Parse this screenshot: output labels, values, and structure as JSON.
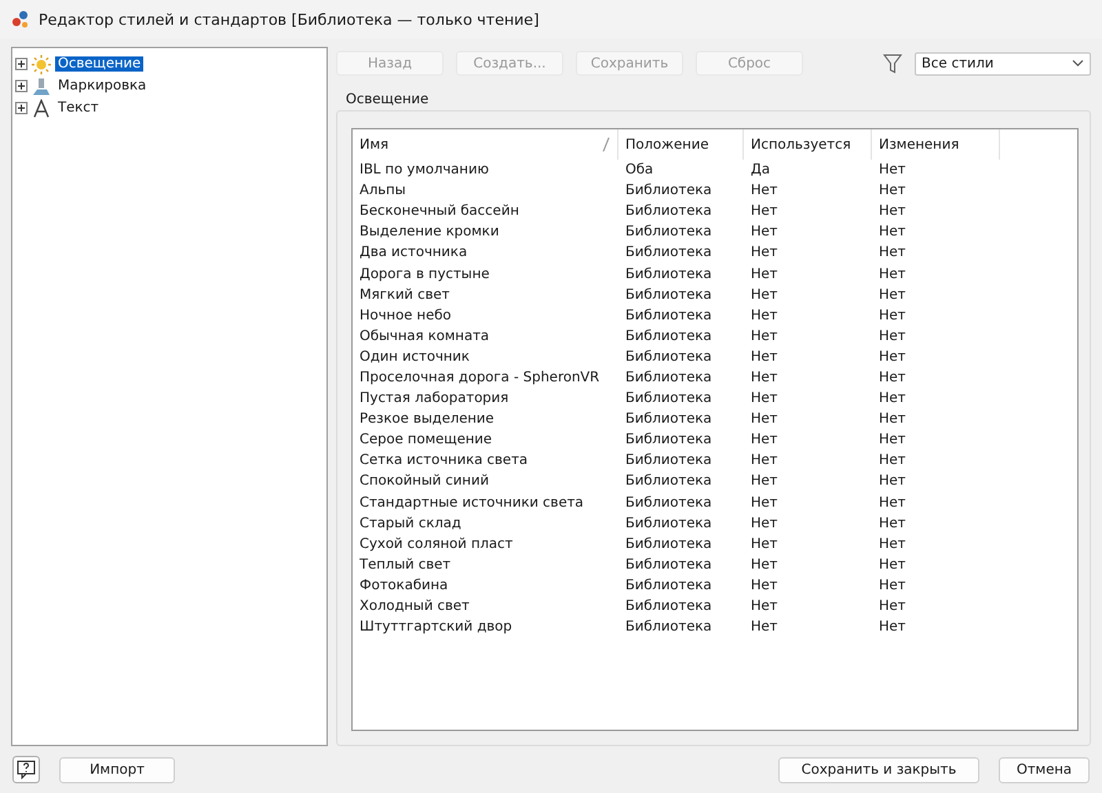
{
  "window": {
    "title": "Редактор стилей и стандартов [Библиотека — только чтение]"
  },
  "tree": [
    {
      "label": "Освещение",
      "selected": true,
      "expanded": false
    },
    {
      "label": "Маркировка",
      "selected": false,
      "expanded": false
    },
    {
      "label": "Текст",
      "selected": false,
      "expanded": false
    }
  ],
  "toolbar": [
    {
      "label": "Назад",
      "disabled": true
    },
    {
      "label": "Создать...",
      "disabled": true
    },
    {
      "label": "Сохранить",
      "disabled": true
    },
    {
      "label": "Сброс",
      "disabled": true
    }
  ],
  "filter": {
    "value": "Все стили"
  },
  "group": {
    "title": "Освещение"
  },
  "table": {
    "columns": [
      "Имя",
      "Положение",
      "Используется",
      "Изменения"
    ],
    "rows": [
      [
        "IBL по умолчанию",
        "Оба",
        "Да",
        "Нет"
      ],
      [
        "Альпы",
        "Библиотека",
        "Нет",
        "Нет"
      ],
      [
        "Бесконечный бассейн",
        "Библиотека",
        "Нет",
        "Нет"
      ],
      [
        "Выделение кромки",
        "Библиотека",
        "Нет",
        "Нет"
      ],
      [
        "Два источника",
        "Библиотека",
        "Нет",
        "Нет"
      ],
      [
        "Дорога в пустыне",
        "Библиотека",
        "Нет",
        "Нет"
      ],
      [
        "Мягкий свет",
        "Библиотека",
        "Нет",
        "Нет"
      ],
      [
        "Ночное небо",
        "Библиотека",
        "Нет",
        "Нет"
      ],
      [
        "Обычная комната",
        "Библиотека",
        "Нет",
        "Нет"
      ],
      [
        "Один источник",
        "Библиотека",
        "Нет",
        "Нет"
      ],
      [
        "Проселочная дорога - SpheronVR",
        "Библиотека",
        "Нет",
        "Нет"
      ],
      [
        "Пустая лаборатория",
        "Библиотека",
        "Нет",
        "Нет"
      ],
      [
        "Резкое выделение",
        "Библиотека",
        "Нет",
        "Нет"
      ],
      [
        "Серое помещение",
        "Библиотека",
        "Нет",
        "Нет"
      ],
      [
        "Сетка источника света",
        "Библиотека",
        "Нет",
        "Нет"
      ],
      [
        "Спокойный синий",
        "Библиотека",
        "Нет",
        "Нет"
      ],
      [
        "Стандартные источники света",
        "Библиотека",
        "Нет",
        "Нет"
      ],
      [
        "Старый склад",
        "Библиотека",
        "Нет",
        "Нет"
      ],
      [
        "Сухой соляной пласт",
        "Библиотека",
        "Нет",
        "Нет"
      ],
      [
        "Теплый свет",
        "Библиотека",
        "Нет",
        "Нет"
      ],
      [
        "Фотокабина",
        "Библиотека",
        "Нет",
        "Нет"
      ],
      [
        "Холодный свет",
        "Библиотека",
        "Нет",
        "Нет"
      ],
      [
        "Штуттгартский двор",
        "Библиотека",
        "Нет",
        "Нет"
      ]
    ]
  },
  "footer": {
    "left_buttons": [
      "Импорт"
    ],
    "right_buttons": [
      "Сохранить и закрыть",
      "Отмена"
    ]
  }
}
